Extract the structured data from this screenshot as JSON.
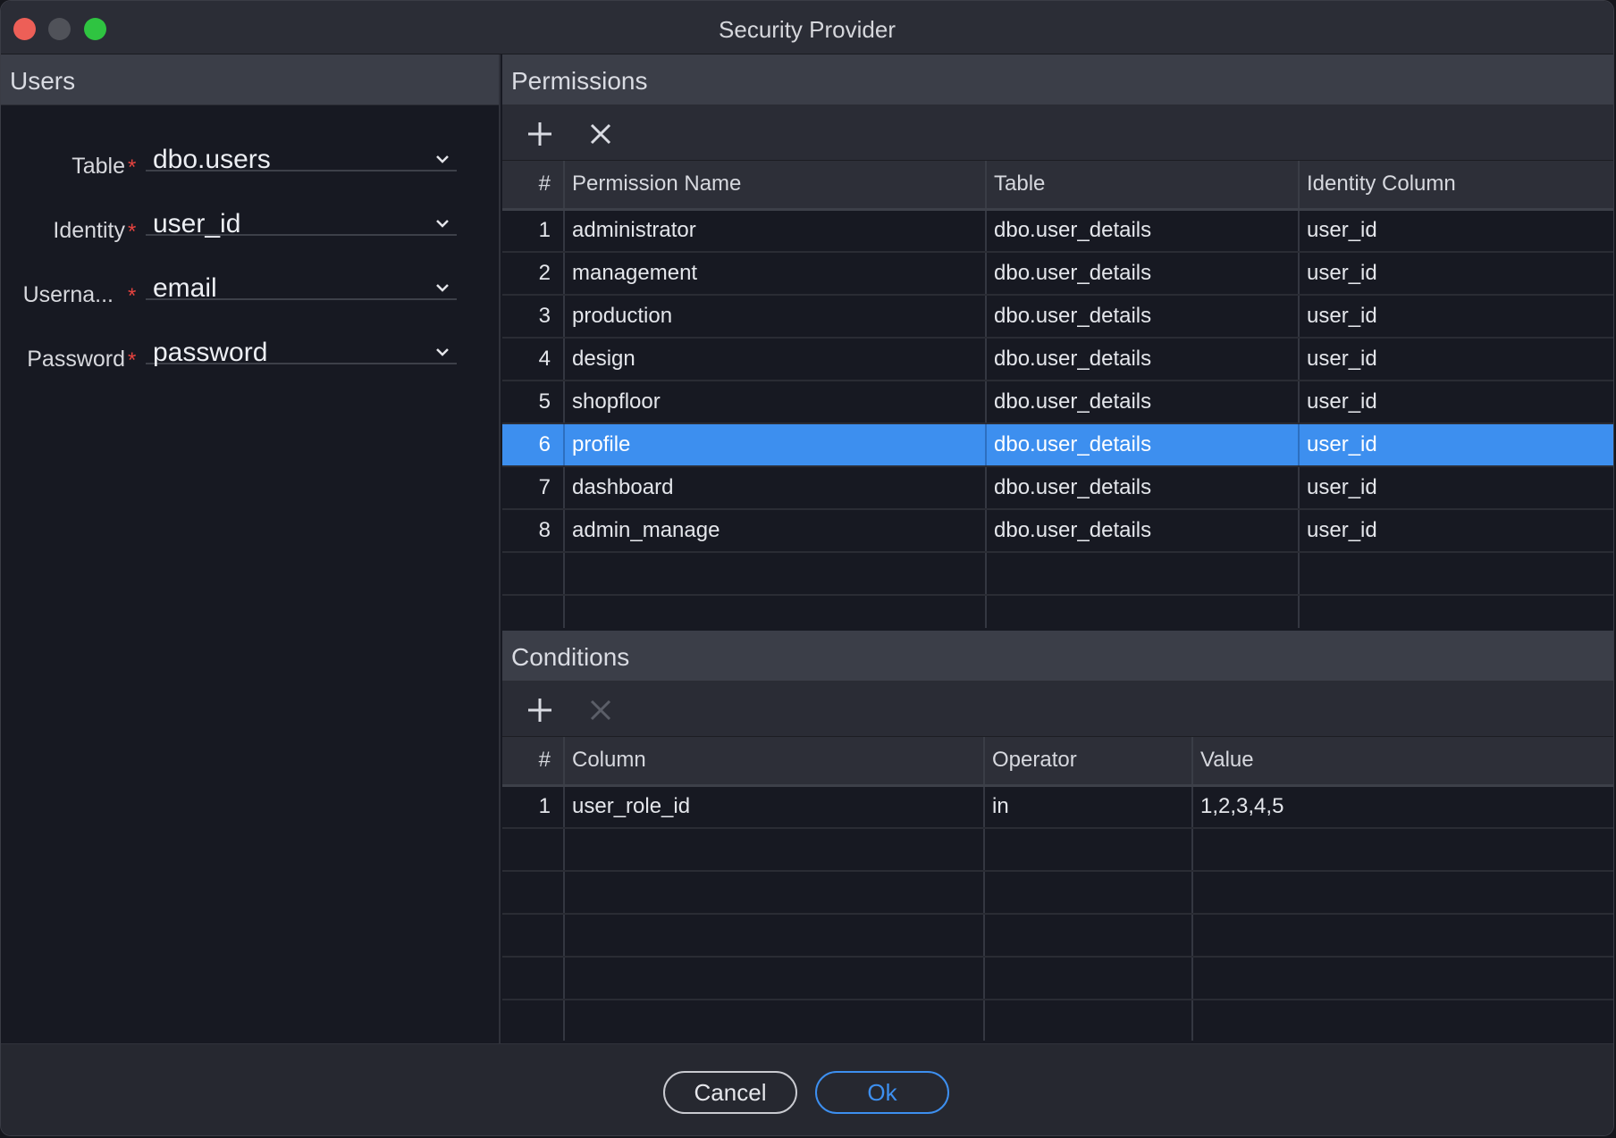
{
  "window": {
    "title": "Security Provider"
  },
  "users": {
    "header": "Users",
    "fields": [
      {
        "label": "Table",
        "value": "dbo.users"
      },
      {
        "label": "Identity",
        "value": "user_id"
      },
      {
        "label": "Userna...",
        "value": "email"
      },
      {
        "label": "Password",
        "value": "password"
      }
    ],
    "required_marker": "*"
  },
  "permissions": {
    "header": "Permissions",
    "columns": [
      "#",
      "Permission Name",
      "Table",
      "Identity Column"
    ],
    "rows": [
      {
        "num": "1",
        "name": "administrator",
        "table": "dbo.user_details",
        "identity": "user_id"
      },
      {
        "num": "2",
        "name": "management",
        "table": "dbo.user_details",
        "identity": "user_id"
      },
      {
        "num": "3",
        "name": "production",
        "table": "dbo.user_details",
        "identity": "user_id"
      },
      {
        "num": "4",
        "name": "design",
        "table": "dbo.user_details",
        "identity": "user_id"
      },
      {
        "num": "5",
        "name": "shopfloor",
        "table": "dbo.user_details",
        "identity": "user_id"
      },
      {
        "num": "6",
        "name": "profile",
        "table": "dbo.user_details",
        "identity": "user_id"
      },
      {
        "num": "7",
        "name": "dashboard",
        "table": "dbo.user_details",
        "identity": "user_id"
      },
      {
        "num": "8",
        "name": "admin_manage",
        "table": "dbo.user_details",
        "identity": "user_id"
      }
    ],
    "selected_row": "6"
  },
  "conditions": {
    "header": "Conditions",
    "columns": [
      "#",
      "Column",
      "Operator",
      "Value"
    ],
    "rows": [
      {
        "num": "1",
        "column": "user_role_id",
        "operator": "in",
        "value": "1,2,3,4,5"
      }
    ]
  },
  "footer": {
    "cancel_label": "Cancel",
    "ok_label": "Ok"
  },
  "icons": {
    "add": "plus-icon",
    "remove": "close-icon",
    "dropdown": "chevron-down-icon"
  },
  "colors": {
    "accent": "#3d8fef",
    "required": "#e5433f"
  }
}
